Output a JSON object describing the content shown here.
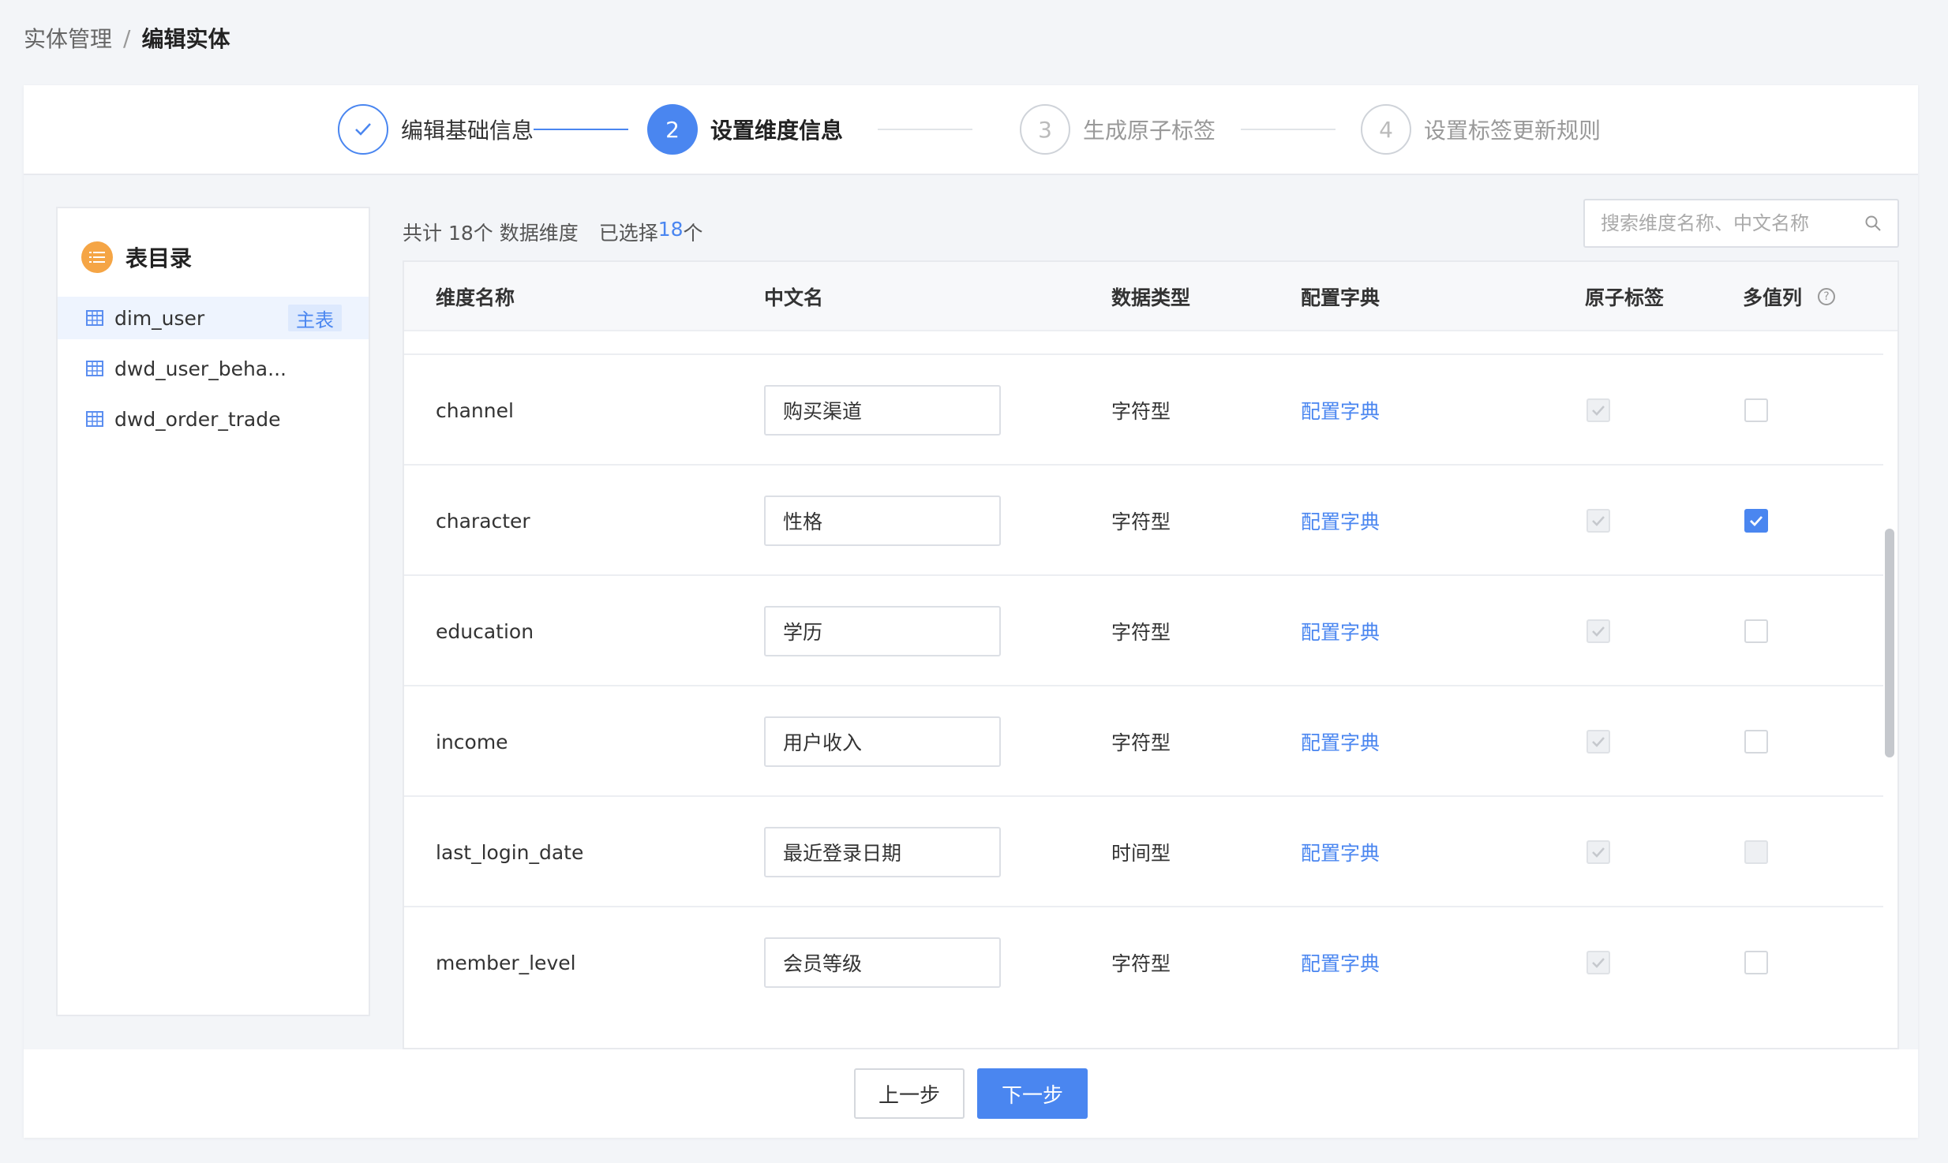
{
  "breadcrumb": {
    "parent": "实体管理",
    "separator": "/",
    "current": "编辑实体"
  },
  "steps": [
    {
      "number": "✓",
      "label": "编辑基础信息",
      "state": "done"
    },
    {
      "number": "2",
      "label": "设置维度信息",
      "state": "active"
    },
    {
      "number": "3",
      "label": "生成原子标签",
      "state": "todo"
    },
    {
      "number": "4",
      "label": "设置标签更新规则",
      "state": "todo"
    }
  ],
  "catalog": {
    "title": "表目录",
    "items": [
      {
        "label": "dim_user",
        "badge": "主表",
        "selected": true
      },
      {
        "label": "dwd_user_beha...",
        "selected": false
      },
      {
        "label": "dwd_order_trade",
        "selected": false
      }
    ]
  },
  "summary": {
    "total_prefix": "共计 18个 数据维度",
    "selected_prefix": "已选择 ",
    "selected_count": "18",
    "selected_suffix": "个"
  },
  "search": {
    "placeholder": "搜索维度名称、中文名称",
    "value": ""
  },
  "table": {
    "headers": {
      "name": "维度名称",
      "cn_name": "中文名",
      "data_type": "数据类型",
      "dict": "配置字典",
      "atomic_tag": "原子标签",
      "multi_value": "多值列"
    },
    "rows": [
      {
        "name": "channel",
        "cn_name": "购买渠道",
        "data_type": "字符型",
        "dict": "配置字典",
        "multi": "unchecked"
      },
      {
        "name": "character",
        "cn_name": "性格",
        "data_type": "字符型",
        "dict": "配置字典",
        "multi": "checked"
      },
      {
        "name": "education",
        "cn_name": "学历",
        "data_type": "字符型",
        "dict": "配置字典",
        "multi": "unchecked"
      },
      {
        "name": "income",
        "cn_name": "用户收入",
        "data_type": "字符型",
        "dict": "配置字典",
        "multi": "unchecked"
      },
      {
        "name": "last_login_date",
        "cn_name": "最近登录日期",
        "data_type": "时间型",
        "dict": "配置字典",
        "multi": "disabled"
      },
      {
        "name": "member_level",
        "cn_name": "会员等级",
        "data_type": "字符型",
        "dict": "配置字典",
        "multi": "unchecked"
      }
    ]
  },
  "footer": {
    "prev_label": "上一步",
    "next_label": "下一步"
  },
  "colors": {
    "accent": "#4a86f0",
    "catalog_icon": "#f5a545"
  }
}
